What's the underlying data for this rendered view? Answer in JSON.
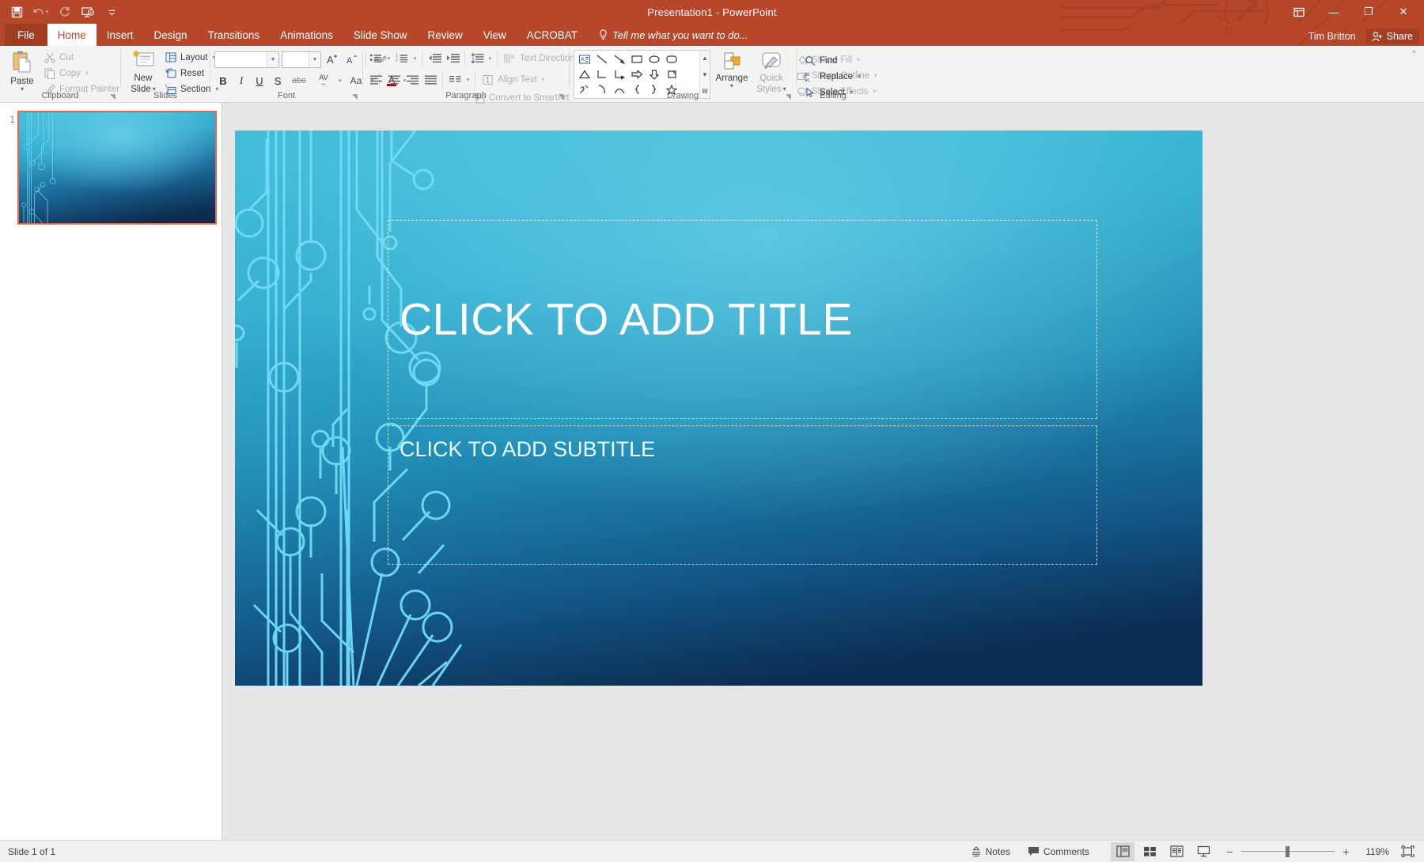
{
  "window": {
    "title": "Presentation1 - PowerPoint",
    "user": "Tim Britton",
    "share_label": "Share",
    "minimize": "—",
    "restore": "❐",
    "close": "✕",
    "ribbon_display_label": "ribbon-display-options"
  },
  "quick_access": [
    {
      "name": "save-icon",
      "label": "Save"
    },
    {
      "name": "undo-icon",
      "label": "Undo"
    },
    {
      "name": "redo-icon",
      "label": "Repeat"
    },
    {
      "name": "start-slideshow-icon",
      "label": "Start From Beginning"
    },
    {
      "name": "customize-qat-icon",
      "label": "Customize Quick Access Toolbar"
    }
  ],
  "tabs": [
    {
      "label": "File",
      "active": false,
      "file": true
    },
    {
      "label": "Home",
      "active": true
    },
    {
      "label": "Insert",
      "active": false
    },
    {
      "label": "Design",
      "active": false
    },
    {
      "label": "Transitions",
      "active": false
    },
    {
      "label": "Animations",
      "active": false
    },
    {
      "label": "Slide Show",
      "active": false
    },
    {
      "label": "Review",
      "active": false
    },
    {
      "label": "View",
      "active": false
    },
    {
      "label": "ACROBAT",
      "active": false
    }
  ],
  "tell_me": "Tell me what you want to do...",
  "ribbon": {
    "clipboard": {
      "group_label": "Clipboard",
      "paste": "Paste",
      "cut": "Cut",
      "copy": "Copy",
      "format_painter": "Format Painter"
    },
    "slides": {
      "group_label": "Slides",
      "new_slide_line1": "New",
      "new_slide_line2": "Slide",
      "layout": "Layout",
      "reset": "Reset",
      "section": "Section"
    },
    "font": {
      "group_label": "Font",
      "font_name": "",
      "font_size": "",
      "grow_font": "A",
      "shrink_font": "A",
      "clear_formatting": "Clear All Formatting",
      "bold": "B",
      "italic": "I",
      "underline": "U",
      "shadow": "S",
      "strikethrough": "abc",
      "character_spacing": "AV",
      "change_case": "Aa",
      "font_color": "A"
    },
    "paragraph": {
      "group_label": "Paragraph",
      "bullets": "Bullets",
      "numbering": "Numbering",
      "decrease_indent": "Decrease List Level",
      "increase_indent": "Increase List Level",
      "line_spacing": "Line Spacing",
      "align_left": "Align Left",
      "center": "Center",
      "align_right": "Align Right",
      "justify": "Justify",
      "columns": "Add or Remove Columns",
      "text_direction": "Text Direction",
      "align_text": "Align Text",
      "convert_to_smartart": "Convert to SmartArt"
    },
    "drawing": {
      "group_label": "Drawing",
      "arrange": "Arrange",
      "quick_styles_line1": "Quick",
      "quick_styles_line2": "Styles",
      "shape_fill": "Shape Fill",
      "shape_outline": "Shape Outline",
      "shape_effects": "Shape Effects",
      "shapes": [
        "text-box-shape",
        "line-shape",
        "line-arrow-shape",
        "rectangle-shape",
        "oval-shape",
        "rounded-rectangle-shape",
        "triangle-shape",
        "elbow-connector-shape",
        "elbow-arrow-connector-shape",
        "right-arrow-shape",
        "down-arrow-shape",
        "folded-corner-shape",
        "freeform-shape",
        "arc-shape",
        "curve-shape",
        "left-brace-shape",
        "right-brace-shape",
        "star-shape"
      ]
    },
    "editing": {
      "group_label": "Editing",
      "find": "Find",
      "replace": "Replace",
      "select": "Select"
    }
  },
  "slides_panel": {
    "slide_number": "1"
  },
  "slide": {
    "title_placeholder": "CLICK TO ADD TITLE",
    "subtitle_placeholder": "CLICK TO ADD SUBTITLE",
    "theme_name": "circuit-theme",
    "colors": {
      "bg_top": "#3fb6d3",
      "bg_bottom": "#0d3a63",
      "trace": "#6fdcf7",
      "accent_orange": "#b7472a",
      "selection": "#e8644a"
    }
  },
  "status_bar": {
    "slide_count": "Slide 1 of 1",
    "notes": "Notes",
    "comments": "Comments",
    "views": [
      {
        "name": "normal-view-button",
        "label": "Normal",
        "selected": true
      },
      {
        "name": "slide-sorter-view-button",
        "label": "Slide Sorter",
        "selected": false
      },
      {
        "name": "reading-view-button",
        "label": "Reading View",
        "selected": false
      },
      {
        "name": "slide-show-button",
        "label": "Slide Show",
        "selected": false
      }
    ],
    "zoom_out": "−",
    "zoom_in": "+",
    "zoom_level": "119%",
    "fit_to_window": "Fit slide to current window"
  }
}
